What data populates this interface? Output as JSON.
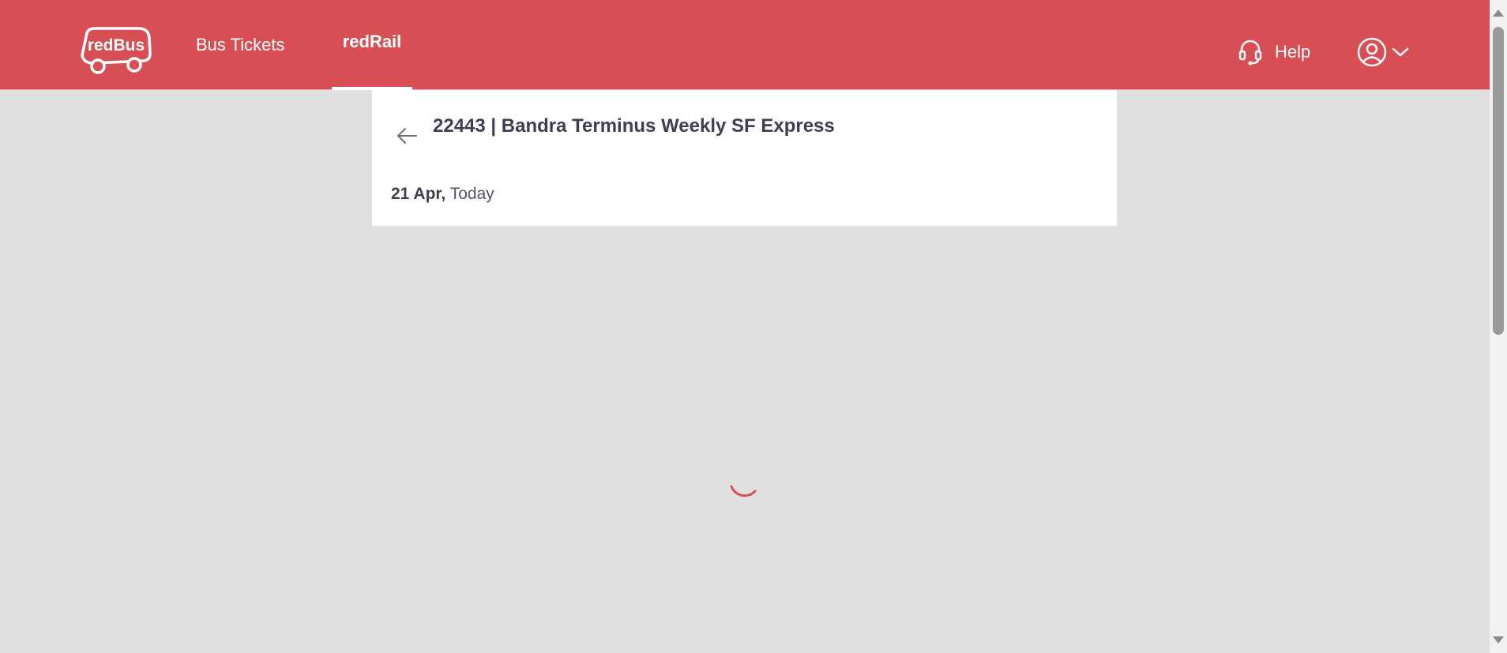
{
  "header": {
    "logo_text": "redBus",
    "nav": {
      "bus_tickets": "Bus Tickets",
      "red_rail": "redRail"
    },
    "help_label": "Help",
    "icons": {
      "help": "headset-icon",
      "profile": "user-circle-icon",
      "dropdown": "chevron-down-icon"
    }
  },
  "train": {
    "title": "22443 | Bandra Terminus Weekly SF Express",
    "date": "21 Apr,",
    "date_relative": "Today"
  },
  "loading": {
    "icon": "loading-spinner-icon"
  },
  "colors": {
    "brand_red": "#d84e55",
    "page_background": "#e0e0e0",
    "text_dark": "#3e3e52"
  }
}
